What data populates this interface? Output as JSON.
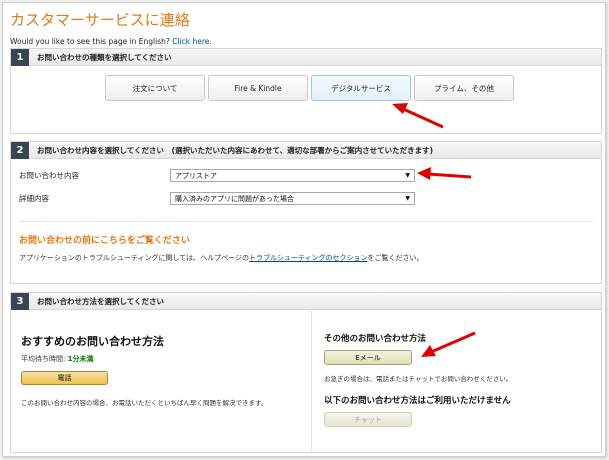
{
  "page": {
    "title": "カスタマーサービスに連絡",
    "english_prompt": "Would you like to see this page in English?",
    "english_link": "Click here."
  },
  "section1": {
    "number": "1",
    "title": "お問い合わせの種類を選択してください",
    "tabs": [
      {
        "label": "注文について",
        "selected": false
      },
      {
        "label": "Fire & Kindle",
        "selected": false
      },
      {
        "label": "デジタルサービス",
        "selected": true
      },
      {
        "label": "プライム、その他",
        "selected": false
      }
    ]
  },
  "section2": {
    "number": "2",
    "title": "お問い合わせ内容を選択してください　(選択いただいた内容にあわせて、適切な部署からご案内させていただきます)",
    "field1_label": "お問い合わせ内容",
    "field1_value": "アプリストア",
    "field2_label": "詳細内容",
    "field2_value": "購入済みのアプリに問題があった場合",
    "help_heading": "お問い合わせの前にこちらをご覧ください",
    "help_text_before": "アプリケーションのトラブルシューティングに関しては、ヘルプページの",
    "help_link": "トラブルシューティングのセクション",
    "help_text_after": "をご覧ください。"
  },
  "section3": {
    "number": "3",
    "title": "お問い合わせ方法を選択してください",
    "recommended_title": "おすすめのお問い合わせ方法",
    "wait_label": "平均待ち時間: ",
    "wait_value": "1分未満",
    "phone_button": "電話",
    "phone_note": "このお問い合わせ内容の場合、お電話いただくといちばん早く問題を解決できます。",
    "other_title": "その他のお問い合わせ方法",
    "email_button": "Eメール",
    "other_note": "お急ぎの場合は、電話またはチャットでお問い合わせください。",
    "unavailable_title": "以下のお問い合わせ方法はご利用いただけません",
    "chat_button": "チャット"
  },
  "colors": {
    "title_orange": "#e47911",
    "step_badge": "#3a4553",
    "link_blue": "#004b91",
    "wait_green": "#007600",
    "annotation_arrow": "#e00000"
  }
}
